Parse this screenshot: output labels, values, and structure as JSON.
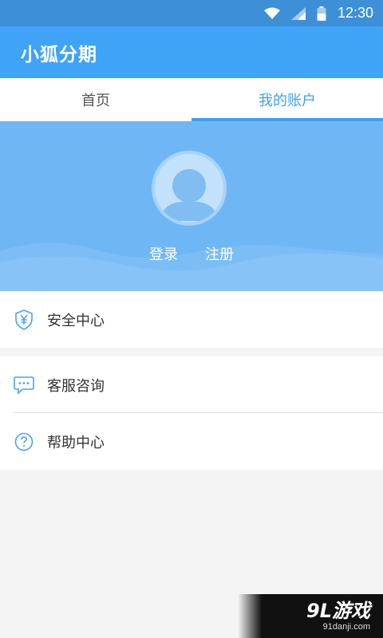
{
  "status_bar": {
    "time": "12:30",
    "icons": [
      "wifi-icon",
      "signal-icon",
      "battery-icon"
    ]
  },
  "app_bar": {
    "title": "小狐分期"
  },
  "tabs": [
    {
      "label": "首页",
      "active": false
    },
    {
      "label": "我的账户",
      "active": true
    }
  ],
  "profile": {
    "avatar_icon": "user-avatar-icon",
    "login_label": "登录",
    "register_label": "注册"
  },
  "menu_groups": [
    {
      "items": [
        {
          "label": "安全中心",
          "icon": "shield-yen-icon"
        }
      ]
    },
    {
      "items": [
        {
          "label": "客服咨询",
          "icon": "chat-bubble-icon"
        },
        {
          "label": "帮助中心",
          "icon": "question-circle-icon"
        }
      ]
    }
  ],
  "watermark": {
    "main": "9L游戏",
    "sub": "91danji.com"
  },
  "colors": {
    "status_bar": "#3d8fd8",
    "app_bar": "#3fa3f6",
    "accent": "#3f9fec",
    "profile_bg": "#6fb6f5",
    "page_bg": "#f4f4f4"
  }
}
